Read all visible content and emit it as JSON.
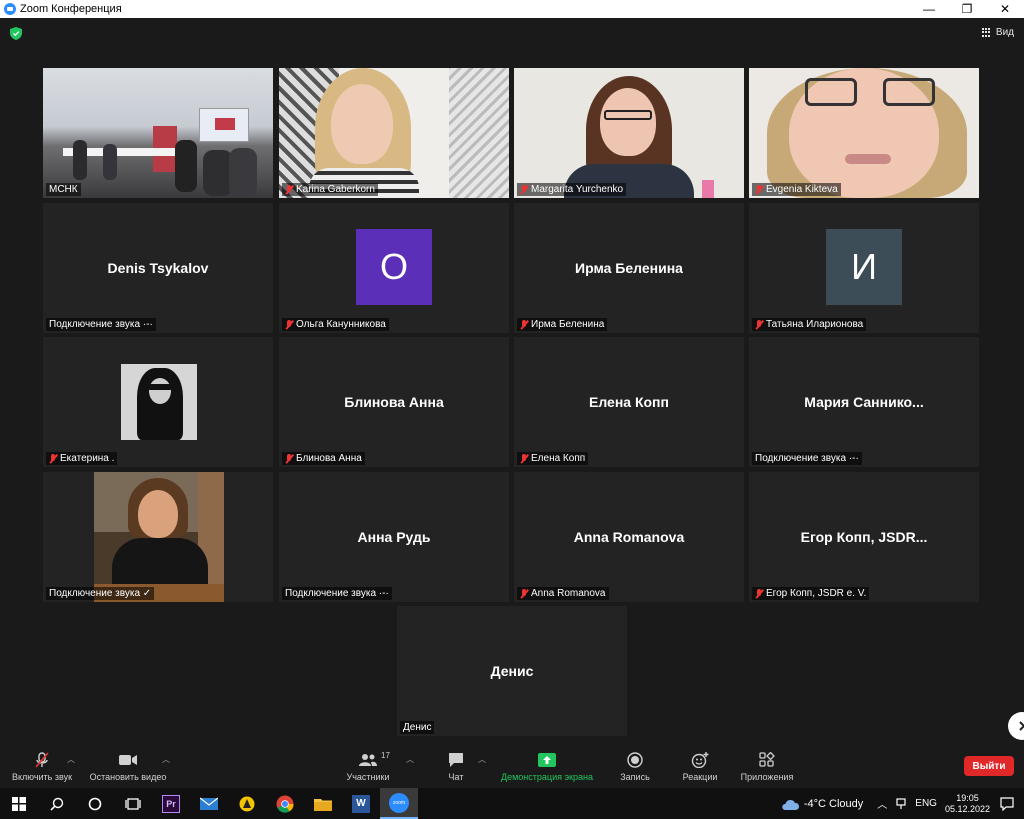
{
  "window": {
    "title": "Zoom Конференция"
  },
  "view": {
    "label": "Вид"
  },
  "tiles": [
    {
      "name": "МСНК",
      "type": "video"
    },
    {
      "name": "Karina Gaberkorn",
      "type": "video",
      "muted": true
    },
    {
      "name": "Margarita Yurchenko",
      "type": "video",
      "muted": true
    },
    {
      "name": "Evgenia Kikteva",
      "type": "video",
      "muted": true
    },
    {
      "center": "Denis Tsykalov",
      "label": "Подключение звука ·-·"
    },
    {
      "avatar_letter": "О",
      "label": "Ольга Канунникова",
      "muted": true,
      "avatar_color": "#5b2fb8"
    },
    {
      "center": "Ирма Беленина",
      "label": "Ирма Беленина",
      "muted": true
    },
    {
      "avatar_letter": "И",
      "label": "Татьяна Иларионова",
      "muted": true,
      "avatar_color": "#3d4d58"
    },
    {
      "label": "Екатерина .",
      "muted": true,
      "type": "photo"
    },
    {
      "center": "Блинова Анна",
      "label": "Блинова Анна",
      "muted": true
    },
    {
      "center": "Елена Копп",
      "label": "Елена Копп",
      "muted": true
    },
    {
      "center": "Мария  Саннико...",
      "label": "Подключение звука ·-·"
    },
    {
      "label": "Подключение звука ✓",
      "type": "photo"
    },
    {
      "center": "Анна Рудь",
      "label": "Подключение звука ·-·"
    },
    {
      "center": "Anna Romanova",
      "label": "Anna Romanova",
      "muted": true
    },
    {
      "center": "Егор  Копп,  JSDR...",
      "label": "Егор Копп, JSDR e. V.",
      "muted": true
    },
    {
      "center": "Денис",
      "label": "Денис"
    }
  ],
  "toolbar": {
    "audio": "Включить звук",
    "video": "Остановить видео",
    "participants": "Участники",
    "participants_count": "17",
    "chat": "Чат",
    "share": "Демонстрация экрана",
    "record": "Запись",
    "reactions": "Реакции",
    "apps": "Приложения",
    "leave": "Выйти"
  },
  "taskbar": {
    "weather": "-4°C  Cloudy",
    "lang": "ENG",
    "time": "19:05",
    "date": "05.12.2022"
  },
  "colors": {
    "active_speaker": "#c5e85a",
    "share_green": "#22c55e",
    "leave_red": "#e02828"
  }
}
